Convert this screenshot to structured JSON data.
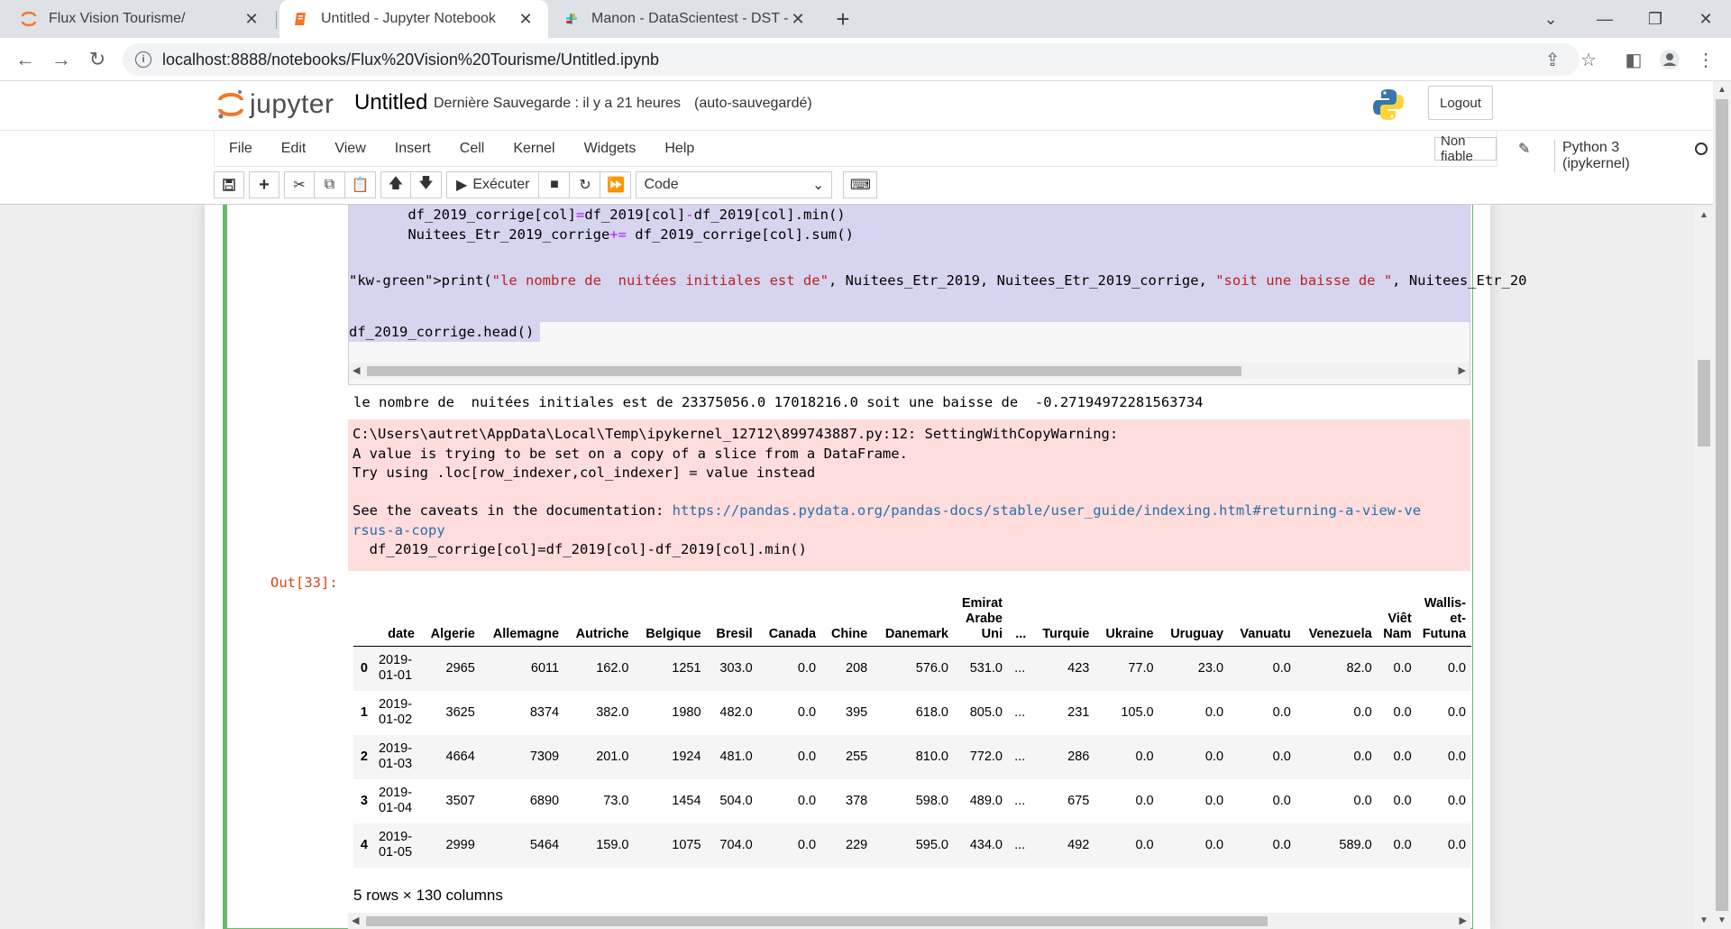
{
  "browser": {
    "tabs": [
      {
        "title": "Flux Vision Tourisme/",
        "icon": "jupyter-icon"
      },
      {
        "title": "Untitled - Jupyter Notebook",
        "icon": "notebook-icon"
      },
      {
        "title": "Manon - DataScientest - DST - D",
        "icon": "slack-icon"
      }
    ],
    "url": "localhost:8888/notebooks/Flux%20Vision%20Tourisme/Untitled.ipynb"
  },
  "header": {
    "logo_text": "jupyter",
    "notebook_name": "Untitled",
    "checkpoint": "Dernière Sauvegarde : il y a 21 heures",
    "autosave": "(auto-sauvegardé)",
    "logout_label": "Logout"
  },
  "menu": {
    "items": [
      "File",
      "Edit",
      "View",
      "Insert",
      "Cell",
      "Kernel",
      "Widgets",
      "Help"
    ],
    "trust_label": "Non fiable",
    "kernel_name": "Python 3 (ipykernel)"
  },
  "toolbar": {
    "run_label": "Exécuter",
    "cell_type": "Code"
  },
  "cell": {
    "code_lines": [
      "       df_2019_corrige[col]=df_2019[col]-df_2019[col].min()",
      "       Nuitees_Etr_2019_corrige+= df_2019_corrige[col].sum()",
      "print(\"le nombre de  nuitées initiales est de\", Nuitees_Etr_2019, Nuitees_Etr_2019_corrige, \"soit une baisse de \", Nuitees_Etr_20",
      "df_2019_corrige.head()"
    ],
    "stdout": "le nombre de  nuitées initiales est de 23375056.0 17018216.0 soit une baisse de  -0.27194972281563734",
    "stderr": {
      "line1": "C:\\Users\\autret\\AppData\\Local\\Temp\\ipykernel_12712\\899743887.py:12: SettingWithCopyWarning:",
      "line2": "A value is trying to be set on a copy of a slice from a DataFrame.",
      "line3": "Try using .loc[row_indexer,col_indexer] = value instead",
      "line4_prefix": "See the caveats in the documentation: ",
      "link_part1": "https://pandas.pydata.org/pandas-docs/stable/user_guide/indexing.html#returning-a-view-ve",
      "link_part2": "rsus-a-copy",
      "line6": "  df_2019_corrige[col]=df_2019[col]-df_2019[col].min()"
    },
    "out_prompt": "Out[33]:",
    "table": {
      "columns": [
        "",
        "date",
        "Algerie",
        "Allemagne",
        "Autriche",
        "Belgique",
        "Bresil",
        "Canada",
        "Chine",
        "Danemark",
        "Emirat Arabe Uni",
        "...",
        "Turquie",
        "Ukraine",
        "Uruguay",
        "Vanuatu",
        "Venezuela",
        "Viêt Nam",
        "Wallis-et-Futuna"
      ],
      "rows": [
        [
          "0",
          "2019-01-01",
          "2965",
          "6011",
          "162.0",
          "1251",
          "303.0",
          "0.0",
          "208",
          "576.0",
          "531.0",
          "...",
          "423",
          "77.0",
          "23.0",
          "0.0",
          "82.0",
          "0.0",
          "0.0"
        ],
        [
          "1",
          "2019-01-02",
          "3625",
          "8374",
          "382.0",
          "1980",
          "482.0",
          "0.0",
          "395",
          "618.0",
          "805.0",
          "...",
          "231",
          "105.0",
          "0.0",
          "0.0",
          "0.0",
          "0.0",
          "0.0"
        ],
        [
          "2",
          "2019-01-03",
          "4664",
          "7309",
          "201.0",
          "1924",
          "481.0",
          "0.0",
          "255",
          "810.0",
          "772.0",
          "...",
          "286",
          "0.0",
          "0.0",
          "0.0",
          "0.0",
          "0.0",
          "0.0"
        ],
        [
          "3",
          "2019-01-04",
          "3507",
          "6890",
          "73.0",
          "1454",
          "504.0",
          "0.0",
          "378",
          "598.0",
          "489.0",
          "...",
          "675",
          "0.0",
          "0.0",
          "0.0",
          "0.0",
          "0.0",
          "0.0"
        ],
        [
          "4",
          "2019-01-05",
          "2999",
          "5464",
          "159.0",
          "1075",
          "704.0",
          "0.0",
          "229",
          "595.0",
          "434.0",
          "...",
          "492",
          "0.0",
          "0.0",
          "0.0",
          "589.0",
          "0.0",
          "0.0"
        ]
      ],
      "shape": "5 rows × 130 columns"
    }
  },
  "colors": {
    "accent_orange": "#f37726",
    "cell_border_green": "#66bb6a",
    "stderr_bg": "#ffdddd",
    "prompt_out": "#d84315"
  }
}
